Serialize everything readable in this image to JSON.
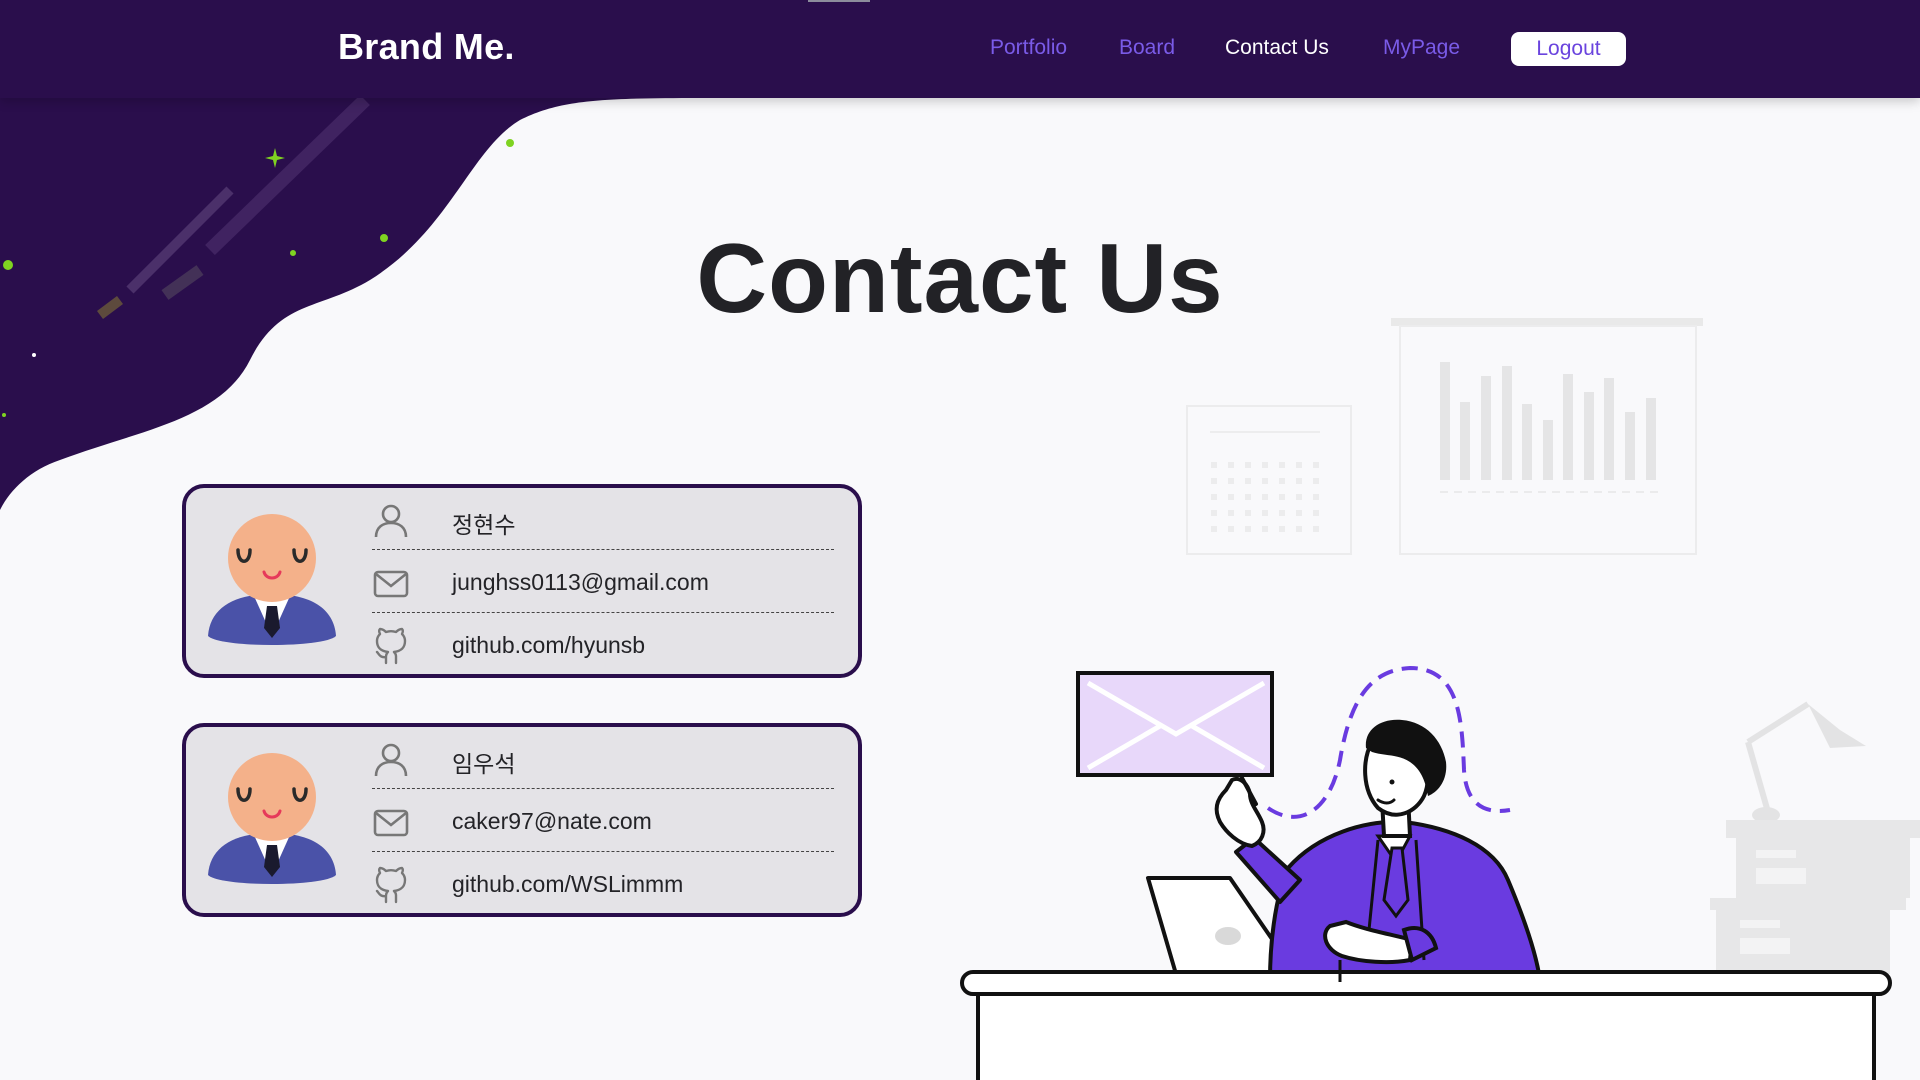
{
  "header": {
    "brand": "Brand Me.",
    "nav": {
      "portfolio": "Portfolio",
      "board": "Board",
      "contact": "Contact Us",
      "mypage": "MyPage"
    },
    "logout_label": "Logout"
  },
  "main": {
    "title": "Contact Us"
  },
  "contacts": [
    {
      "name": "정현수",
      "email": "junghss0113@gmail.com",
      "github": "github.com/hyunsb"
    },
    {
      "name": "임우석",
      "email": "caker97@nate.com",
      "github": "github.com/WSLimmm"
    }
  ],
  "colors": {
    "nav_bg": "#2a0e4c",
    "accent": "#7a5be8",
    "card_bg": "#e4e3e7",
    "suit": "#6a3be0"
  },
  "icons": [
    "person-icon",
    "mail-icon",
    "github-icon"
  ]
}
